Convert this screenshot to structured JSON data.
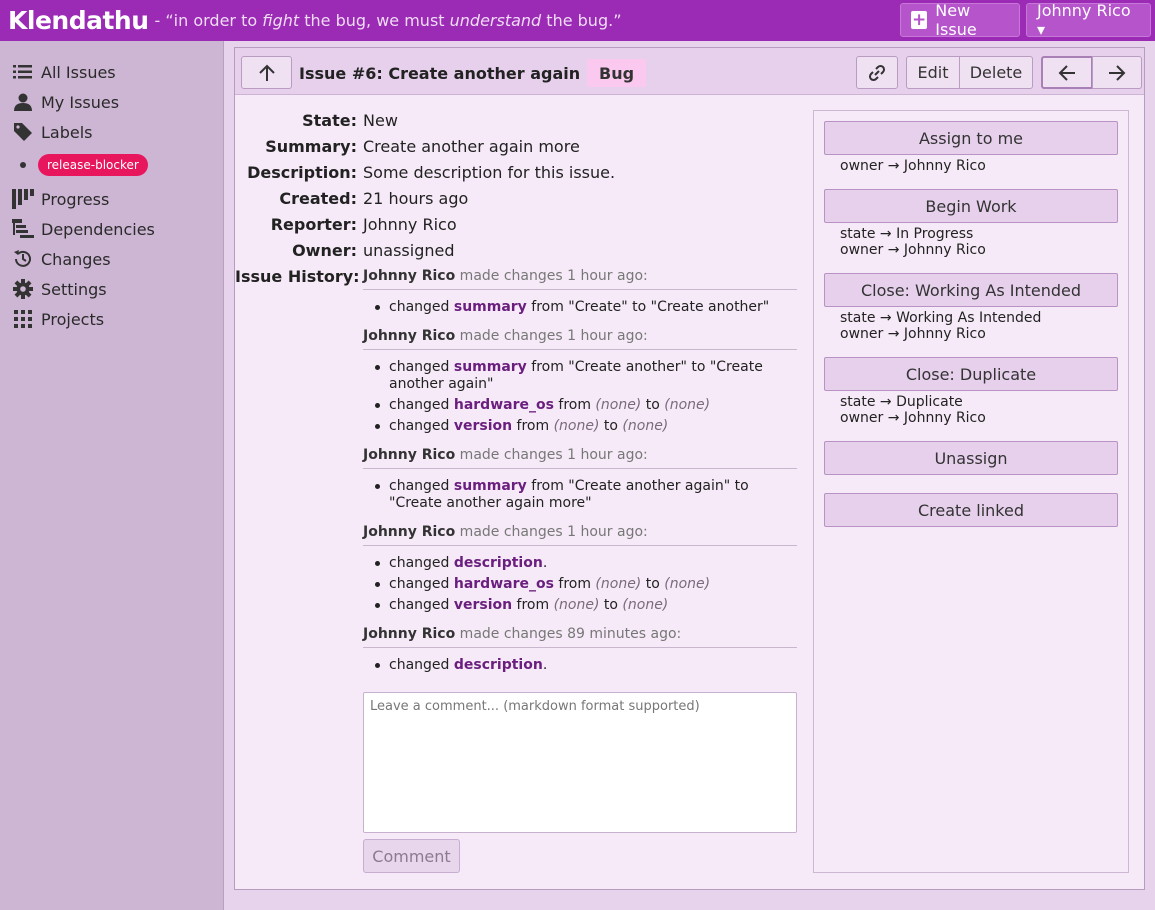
{
  "app": {
    "brand": "Klendathu",
    "tagline_prefix": " - “in order to ",
    "tagline_em1": "fight",
    "tagline_mid": " the bug, we must ",
    "tagline_em2": "understand",
    "tagline_suffix": " the bug.”",
    "new_issue_label": "New Issue",
    "user_menu_label": "Johnny Rico ▾"
  },
  "sidebar": {
    "items": [
      {
        "label": "All Issues",
        "icon": "list-icon"
      },
      {
        "label": "My Issues",
        "icon": "person-icon"
      },
      {
        "label": "Labels",
        "icon": "tag-icon"
      },
      {
        "label": "Progress",
        "icon": "kanban-icon"
      },
      {
        "label": "Dependencies",
        "icon": "dependencies-icon"
      },
      {
        "label": "Changes",
        "icon": "history-icon"
      },
      {
        "label": "Settings",
        "icon": "gear-icon"
      },
      {
        "label": "Projects",
        "icon": "grid-icon"
      }
    ],
    "label_badge": "release-blocker",
    "label_badge_color": "#e8175d"
  },
  "toolbar": {
    "title": "Issue #6:  Create another again more",
    "type_tag": "Bug",
    "edit_label": "Edit",
    "delete_label": "Delete"
  },
  "fields": [
    {
      "label": "State:",
      "value": "New"
    },
    {
      "label": "Summary:",
      "value": "Create another again more"
    },
    {
      "label": "Description:",
      "value": "Some description for this issue."
    },
    {
      "label": "Created:",
      "value": "21 hours ago"
    },
    {
      "label": "Reporter:",
      "value": "Johnny Rico"
    },
    {
      "label": "Owner:",
      "value": "unassigned"
    }
  ],
  "history": {
    "label": "Issue History:",
    "entries": [
      {
        "author": "Johnny Rico",
        "when": " made changes 1 hour ago:"
      },
      {
        "author": "Johnny Rico",
        "when": " made changes 1 hour ago:"
      },
      {
        "author": "Johnny Rico",
        "when": " made changes 1 hour ago:"
      },
      {
        "author": "Johnny Rico",
        "when": " made changes 1 hour ago:"
      },
      {
        "author": "Johnny Rico",
        "when": " made changes 89 minutes ago:"
      }
    ],
    "changes": [
      {
        "pre": "changed ",
        "field": "summary",
        "post": " from \"Create\" to \"Create another\""
      },
      {
        "pre": "changed ",
        "field": "summary",
        "post": " from \"Create another\" to \"Create another again\""
      },
      {
        "pre": "changed ",
        "field": "hardware_os",
        "post": " from ",
        "from": "(none)",
        "to_word": " to ",
        "to": "(none)"
      },
      {
        "pre": "changed ",
        "field": "version",
        "post": " from ",
        "from": "(none)",
        "to_word": " to ",
        "to": "(none)"
      },
      {
        "pre": "changed ",
        "field": "summary",
        "post": " from \"Create another again\" to \"Create another again more\""
      },
      {
        "pre": "changed ",
        "field": "description",
        "post": "."
      },
      {
        "pre": "changed ",
        "field": "hardware_os",
        "post": " from ",
        "from": "(none)",
        "to_word": " to ",
        "to": "(none)"
      },
      {
        "pre": "changed ",
        "field": "version",
        "post": " from ",
        "from": "(none)",
        "to_word": " to ",
        "to": "(none)"
      },
      {
        "pre": "changed ",
        "field": "description",
        "post": "."
      }
    ]
  },
  "comment": {
    "placeholder": "Leave a comment... (markdown format supported)",
    "button_label": "Comment"
  },
  "actions": [
    {
      "label": "Assign to me",
      "notes": [
        "owner → Johnny Rico"
      ]
    },
    {
      "label": "Begin Work",
      "notes": [
        "state → In Progress",
        "owner → Johnny Rico"
      ]
    },
    {
      "label": "Close: Working As Intended",
      "notes": [
        "state → Working As Intended",
        "owner → Johnny Rico"
      ]
    },
    {
      "label": "Close: Duplicate",
      "notes": [
        "state → Duplicate",
        "owner → Johnny Rico"
      ]
    },
    {
      "label": "Unassign",
      "notes": []
    },
    {
      "label": "Create linked",
      "notes": []
    }
  ],
  "colors": {
    "topbar": "#9b2ab5",
    "sidebar": "#cdb6d3",
    "panel": "#f6eaf8",
    "accent_text": "#6a1f7e"
  }
}
